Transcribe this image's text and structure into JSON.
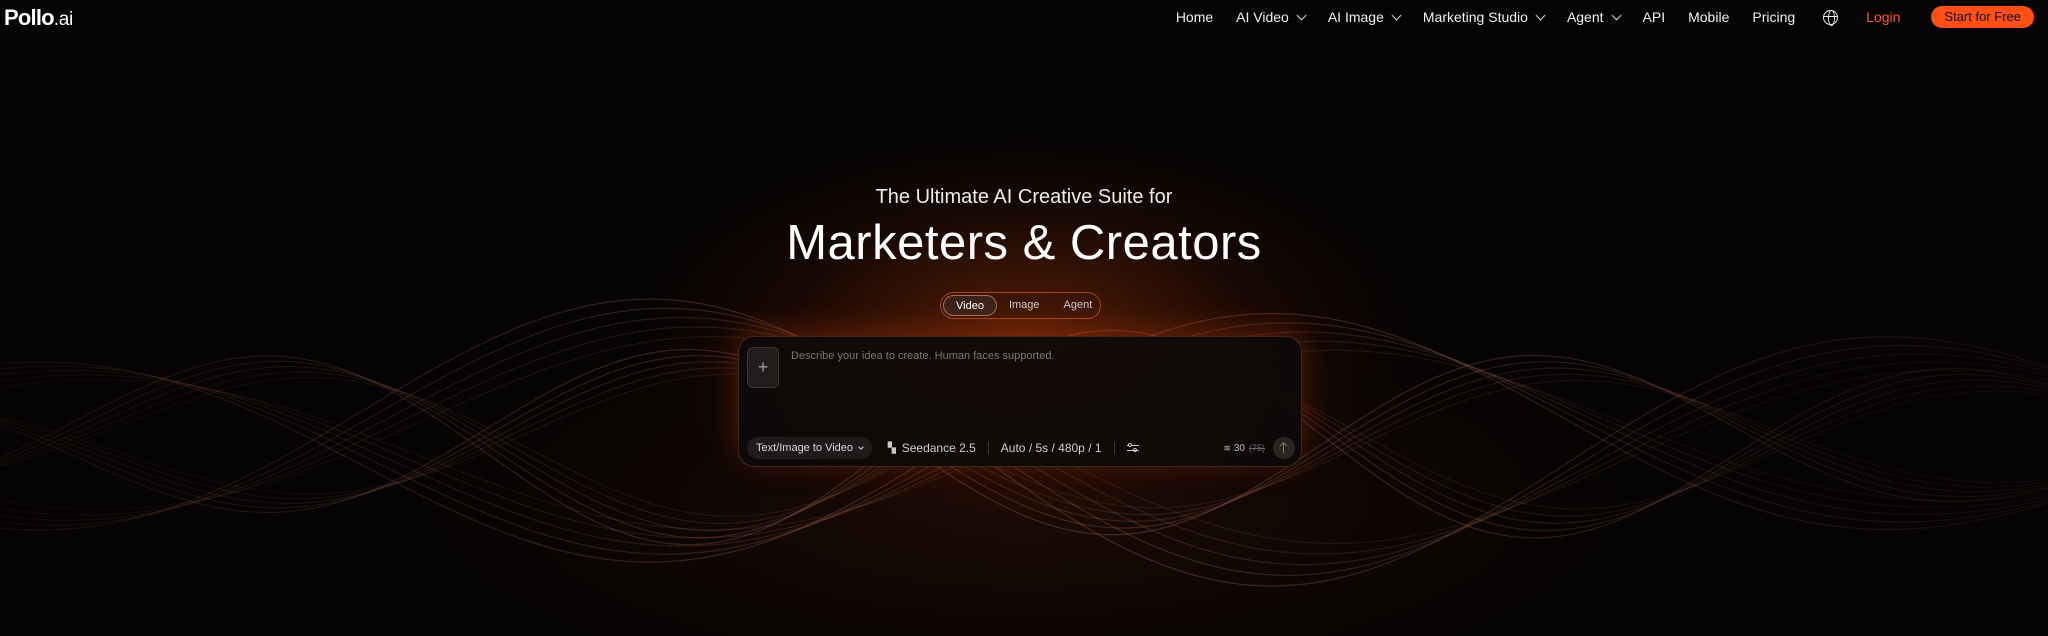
{
  "brand": {
    "logo_main": "Pollo",
    "logo_suffix": ".ai"
  },
  "nav": {
    "items": [
      {
        "label": "Home",
        "dropdown": false
      },
      {
        "label": "AI Video",
        "dropdown": true
      },
      {
        "label": "AI Image",
        "dropdown": true
      },
      {
        "label": "Marketing Studio",
        "dropdown": true
      },
      {
        "label": "Agent",
        "dropdown": true
      },
      {
        "label": "API",
        "dropdown": false
      },
      {
        "label": "Mobile",
        "dropdown": false
      },
      {
        "label": "Pricing",
        "dropdown": false
      }
    ],
    "language_icon": "globe-icon",
    "login_label": "Login",
    "cta_label": "Start for Free"
  },
  "hero": {
    "subtitle": "The Ultimate AI Creative Suite for",
    "title": "Marketers & Creators"
  },
  "mode_tabs": [
    {
      "label": "Video",
      "active": true
    },
    {
      "label": "Image",
      "active": false
    },
    {
      "label": "Agent",
      "active": false
    }
  ],
  "prompt": {
    "placeholder": "Describe your idea to create. Human faces supported.",
    "value": "",
    "add_icon": "plus-icon",
    "mode_select": "Text/Image to Video",
    "model": "Seedance 2.5",
    "settings_summary": "Auto / 5s / 480p / 1",
    "settings_icon": "sliders-icon",
    "credits": "30",
    "credits_original": "75",
    "send_icon": "arrow-up-icon"
  },
  "colors": {
    "accent": "#ff4f16",
    "login": "#ff5a2a",
    "background": "#050303"
  }
}
